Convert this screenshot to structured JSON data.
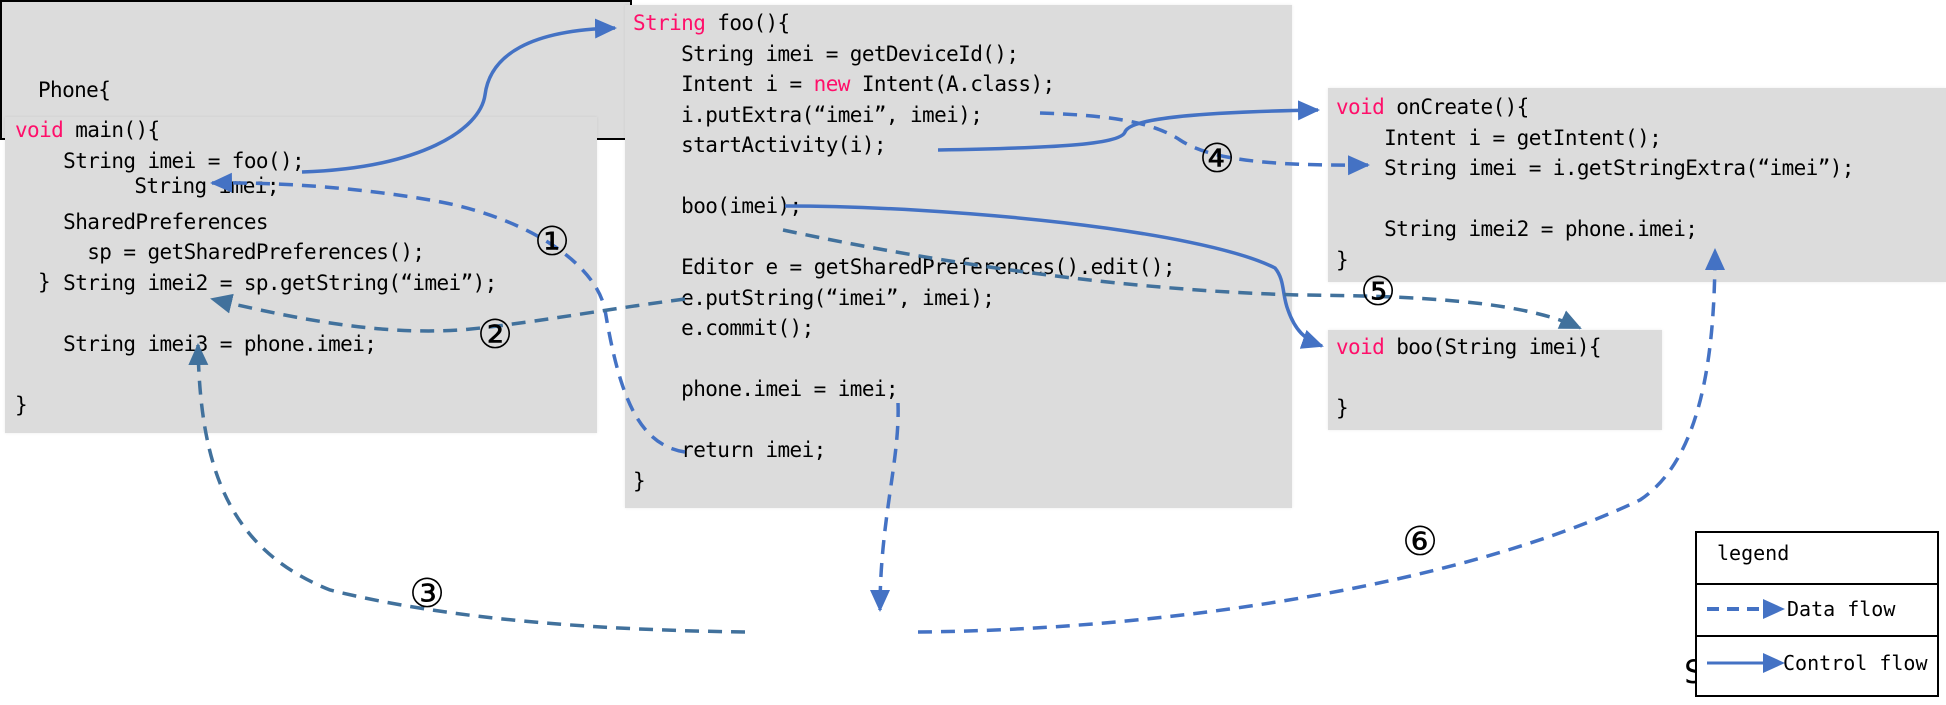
{
  "colors": {
    "keyword": "#ff0f6a",
    "data_flow": "#4472c4",
    "data_flow_dark": "#41719c",
    "control_flow": "#4472c4",
    "code_bg": "#dcdcdc"
  },
  "main": {
    "lines": [
      {
        "kw": "void",
        "text": " main(){"
      },
      {
        "kw": "",
        "text": "    String imei = foo();"
      },
      {
        "kw": "",
        "text": ""
      },
      {
        "kw": "",
        "text": "    SharedPreferences"
      },
      {
        "kw": "",
        "text": "      sp = getSharedPreferences();"
      },
      {
        "kw": "",
        "text": "    String imei2 = sp.getString(“imei”);"
      },
      {
        "kw": "",
        "text": ""
      },
      {
        "kw": "",
        "text": "    String imei3 = phone.imei;"
      },
      {
        "kw": "",
        "text": ""
      },
      {
        "kw": "",
        "text": "}"
      }
    ]
  },
  "foo": {
    "lines": [
      {
        "kw": "String",
        "text": " foo(){"
      },
      {
        "kw": "",
        "text": "    String imei = getDeviceId();"
      },
      {
        "kw": "",
        "text": "    Intent i = ",
        "kw2": "new",
        "text2": " Intent(A.class);"
      },
      {
        "kw": "",
        "text": "    i.putExtra(“imei”, imei);"
      },
      {
        "kw": "",
        "text": "    startActivity(i);"
      },
      {
        "kw": "",
        "text": ""
      },
      {
        "kw": "",
        "text": "    boo(imei);"
      },
      {
        "kw": "",
        "text": ""
      },
      {
        "kw": "",
        "text": "    Editor e = getSharedPreferences().edit();"
      },
      {
        "kw": "",
        "text": "    e.putString(“imei”, imei);"
      },
      {
        "kw": "",
        "text": "    e.commit();"
      },
      {
        "kw": "",
        "text": ""
      },
      {
        "kw": "",
        "text": "    phone.imei = imei;"
      },
      {
        "kw": "",
        "text": ""
      },
      {
        "kw": "",
        "text": "    return imei;"
      },
      {
        "kw": "",
        "text": "}"
      }
    ]
  },
  "oncreate": {
    "lines": [
      {
        "kw": "void",
        "text": " onCreate(){"
      },
      {
        "kw": "",
        "text": "    Intent i = getIntent();"
      },
      {
        "kw": "",
        "text": "    String imei = i.getStringExtra(“imei”);"
      },
      {
        "kw": "",
        "text": ""
      },
      {
        "kw": "",
        "text": "    String imei2 = phone.imei;"
      },
      {
        "kw": "",
        "text": "}"
      }
    ]
  },
  "boo": {
    "lines": [
      {
        "kw": "void",
        "text": " boo(String imei){"
      },
      {
        "kw": "",
        "text": ""
      },
      {
        "kw": "",
        "text": "}"
      }
    ]
  },
  "phone": {
    "lines": [
      "Phone{",
      "        String imei;",
      "}"
    ],
    "label": "Shared Memory"
  },
  "flow_labels": [
    "①",
    "②",
    "③",
    "④",
    "⑤",
    "⑥"
  ],
  "legend": {
    "title": "legend",
    "items": [
      {
        "icon": "dashed-arrow",
        "label": "Data flow"
      },
      {
        "icon": "solid-arrow",
        "label": "Control flow"
      }
    ]
  }
}
